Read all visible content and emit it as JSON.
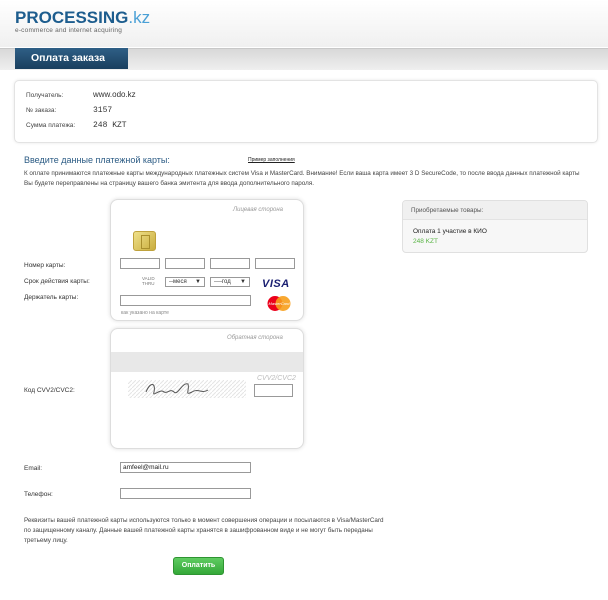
{
  "header": {
    "logo_main": "PROCESSING",
    "logo_tld": ".kz",
    "logo_sub": "e-commerce and internet acquiring"
  },
  "page_title": "Оплата заказа",
  "order_info": {
    "recipient_label": "Получатель:",
    "recipient_value": "www.odo.kz",
    "order_label": "№ заказа:",
    "order_value": "3157",
    "amount_label": "Сумма платежа:",
    "amount_value": "248 KZT"
  },
  "card_section": {
    "title": "Введите данные платежной карты:",
    "sample_link": "Пример заполнения",
    "notice": "К оплате принимаются платежные карты международных платежных систем Visa и MasterCard. Внимание! Если ваша карта имеет 3 D SecureCode, то после ввода данных платежной карты Вы будете переправлены на страницу вашего банка эмитента для ввода дополнительного пароля.",
    "front_side_label": "Лицевая сторона",
    "back_side_label": "Обратная сторона",
    "card_number_label": "Номер карты:",
    "expiry_label": "Срок действия карты:",
    "valid_thru": "VALID THRU",
    "month_select": "--меся",
    "year_select": "----год",
    "holder_label": "Держатель карты:",
    "holder_hint": "как указано на карте",
    "cvv_label": "Код CVV2/CVC2:",
    "cvv_hint": "CVV2/CVC2",
    "visa_logo": "VISA",
    "mastercard_logo": "MasterCard"
  },
  "goods": {
    "title": "Приобретаемые товары:",
    "item": "Оплата 1 участие в КИО",
    "price": "248 KZT"
  },
  "contacts": {
    "email_label": "Email:",
    "email_value": "amfeel@mail.ru",
    "phone_label": "Телефон:",
    "phone_value": ""
  },
  "footer_note": "Реквизиты вашей платежной карты используются только в момент совершения операции и посылаются в Visa/MasterCard по защищенному каналу. Данные вашей платежной карты хранятся в зашифрованном виде и не могут быть переданы третьему лицу.",
  "pay_button": "Оплатить",
  "colors": {
    "brand_blue": "#1d5d8e",
    "title_band": "#1a3f5e",
    "pay_green": "#34a838",
    "price_green": "#5ab446"
  }
}
